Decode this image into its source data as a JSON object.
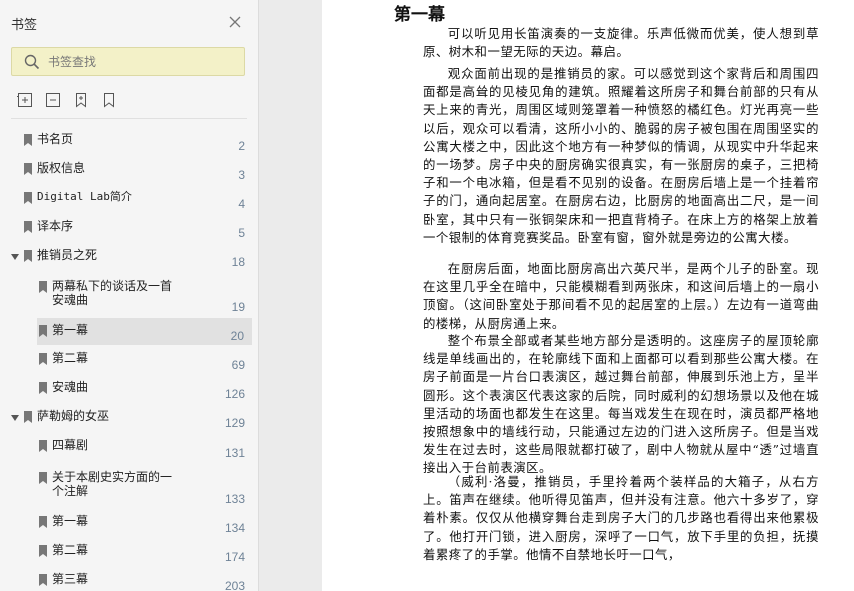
{
  "sidebar": {
    "title": "书签",
    "search_placeholder": "书签查找",
    "items": [
      {
        "label": "书名页",
        "page": "2"
      },
      {
        "label": "版权信息",
        "page": "3"
      },
      {
        "label": "Digital Lab简介",
        "page": "4"
      },
      {
        "label": "译本序",
        "page": "5"
      },
      {
        "label": "推销员之死",
        "page": "18"
      },
      {
        "label": "两幕私下的谈话及一首\n安魂曲",
        "page": "19"
      },
      {
        "label": "第一幕",
        "page": "20"
      },
      {
        "label": "第二幕",
        "page": "69"
      },
      {
        "label": "安魂曲",
        "page": "126"
      },
      {
        "label": "萨勒姆的女巫",
        "page": "129"
      },
      {
        "label": "四幕剧",
        "page": "131"
      },
      {
        "label": "关于本剧史实方面的一\n个注解",
        "page": "133"
      },
      {
        "label": "第一幕",
        "page": "134"
      },
      {
        "label": "第二幕",
        "page": "174"
      },
      {
        "label": "第三幕",
        "page": "203"
      }
    ]
  },
  "document": {
    "heading": "第一幕",
    "paragraphs": [
      "可以听见用长笛演奏的一支旋律。乐声低微而优美，使人想到草原、树木和一望无际的天边。幕启。",
      "观众面前出现的是推销员的家。可以感觉到这个家背后和周围四面都是高耸的见棱见角的建筑。照耀着这所房子和舞台前部的只有从天上来的青光，周围区域则笼罩着一种愤怒的橘红色。灯光再亮一些以后，观众可以看清，这所小小的、脆弱的房子被包围在周围坚实的公寓大楼之中，因此这个地方有一种梦似的情调，从现实中升华起来的一场梦。房子中央的厨房确实很真实，有一张厨房的桌子，三把椅子和一个电冰箱，但是看不见别的设备。在厨房后墙上是一个挂着帘子的门，通向起居室。在厨房右边，比厨房的地面高出二尺，是一间卧室，其中只有一张铜架床和一把直背椅子。在床上方的格架上放着一个银制的体育竞赛奖品。卧室有窗，窗外就是旁边的公寓大楼。",
      "在厨房后面，地面比厨房高出六英尺半，是两个儿子的卧室。现在这里几乎全在暗中，只能模糊看到两张床，和这间后墙上的一扇小顶窗。（这间卧室处于那间看不见的起居室的上层。）左边有一道弯曲的楼梯，从厨房通上来。",
      "整个布景全部或者某些地方部分是透明的。这座房子的屋顶轮廓线是单线画出的，在轮廓线下面和上面都可以看到那些公寓大楼。在房子前面是一片台口表演区，越过舞台前部，伸展到乐池上方，呈半圆形。这个表演区代表这家的后院，同时威利的幻想场景以及他在城里活动的场面也都发生在这里。每当戏发生在现在时，演员都严格地按照想象中的墙线行动，只能通过左边的门进入这所房子。但是当戏发生在过去时，这些局限就都打破了，剧中人物就从屋中“透”过墙直接出入于台前表演区。",
      "（威利·洛曼，推销员，手里拎着两个装样品的大箱子，从右方上。笛声在继续。他听得见笛声，但并没有注意。他六十多岁了，穿着朴素。仅仅从他横穿舞台走到房子大门的几步路也看得出来他累极了。他打开门锁，进入厨房，深呼了一口气，放下手里的负担，抚摸着累疼了的手掌。他情不自禁地长吁一口气，"
    ]
  }
}
